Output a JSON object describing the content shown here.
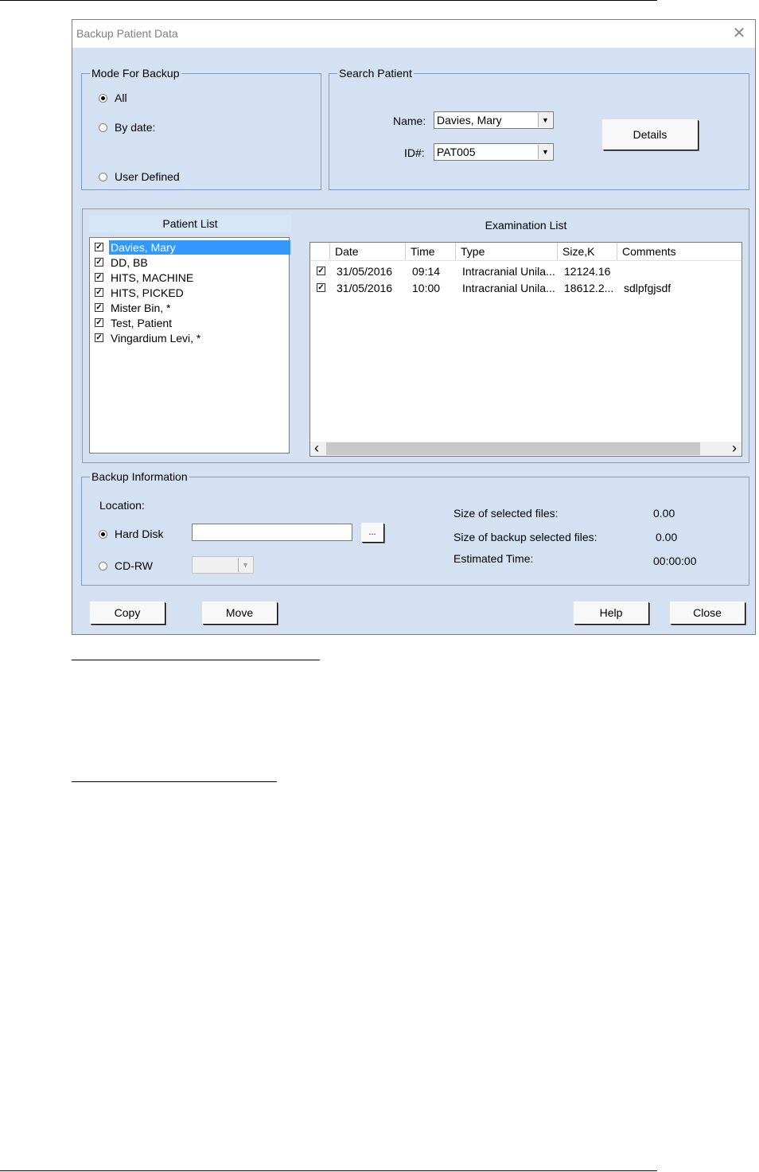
{
  "window": {
    "title": "Backup Patient Data",
    "close_glyph": "✕"
  },
  "mode_group": {
    "legend": "Mode For Backup",
    "options": [
      {
        "label": "All",
        "selected": true
      },
      {
        "label": "By date:",
        "selected": false
      },
      {
        "label": "User Defined",
        "selected": false
      }
    ]
  },
  "search_group": {
    "legend": "Search Patient",
    "name_label": "Name:",
    "name_value": "Davies, Mary",
    "id_label": "ID#:",
    "id_value": "PAT005",
    "details_button": "Details"
  },
  "patient_list": {
    "header": "Patient List",
    "items": [
      {
        "name": "Davies, Mary",
        "checked": true,
        "selected": true
      },
      {
        "name": "DD, BB",
        "checked": true,
        "selected": false
      },
      {
        "name": "HITS, MACHINE",
        "checked": true,
        "selected": false
      },
      {
        "name": "HITS, PICKED",
        "checked": true,
        "selected": false
      },
      {
        "name": "Mister Bin, *",
        "checked": true,
        "selected": false
      },
      {
        "name": "Test, Patient",
        "checked": true,
        "selected": false
      },
      {
        "name": "Vingardium Levi, *",
        "checked": true,
        "selected": false
      }
    ]
  },
  "exam_list": {
    "header": "Examination List",
    "columns": [
      "Date",
      "Time",
      "Type",
      "Size,K",
      "Comments"
    ],
    "rows": [
      {
        "checked": true,
        "date": "31/05/2016",
        "time": "09:14",
        "type": "Intracranial Unila...",
        "size": "12124.16",
        "comments": ""
      },
      {
        "checked": true,
        "date": "31/05/2016",
        "time": "10:00",
        "type": "Intracranial Unila...",
        "size": "18612.2...",
        "comments": "sdlpfgjsdf"
      }
    ],
    "scroll_left": "‹",
    "scroll_right": "›"
  },
  "backup_info": {
    "legend": "Backup Information",
    "location_label": "Location:",
    "hard_disk_label": "Hard Disk",
    "hard_disk_selected": true,
    "hard_disk_path": "",
    "browse_button": "...",
    "cdrw_label": "CD-RW",
    "cdrw_selected": false,
    "size_selected_label": "Size of selected files:",
    "size_selected_value": "0.00",
    "size_backup_label": "Size of backup selected files:",
    "size_backup_value": "0.00",
    "est_time_label": "Estimated Time:",
    "est_time_value": "00:00:00"
  },
  "buttons": {
    "copy": "Copy",
    "move": "Move",
    "help": "Help",
    "close": "Close"
  }
}
